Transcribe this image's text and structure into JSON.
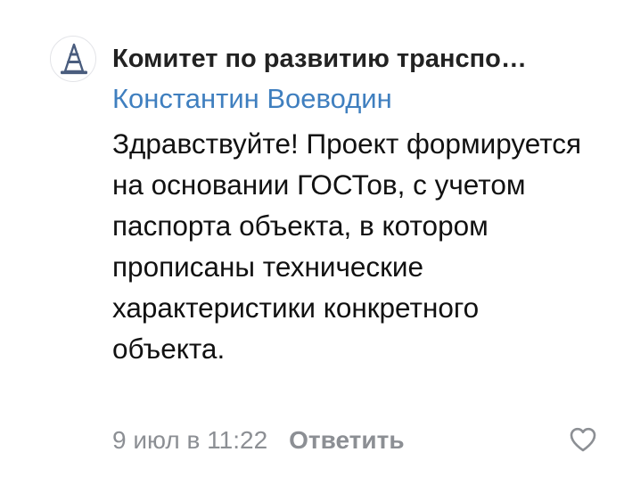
{
  "comment": {
    "author": "Комитет по развитию транспо…",
    "reply_to": "Константин Воеводин",
    "text": "Здравствуйте! Проект формируется на основании ГОСТов, с учетом паспорта объекта, в котором прописаны технические характеристики конкретного объекта.",
    "timestamp": "9 июл в 11:22",
    "reply_label": "Ответить",
    "avatar_icon": "traffic-cone-icon",
    "like_icon": "heart-outline-icon"
  },
  "colors": {
    "link": "#3f7fbf",
    "secondary_text": "#8c8f94",
    "primary_text": "#111111",
    "cone": "#4a5d7e"
  }
}
